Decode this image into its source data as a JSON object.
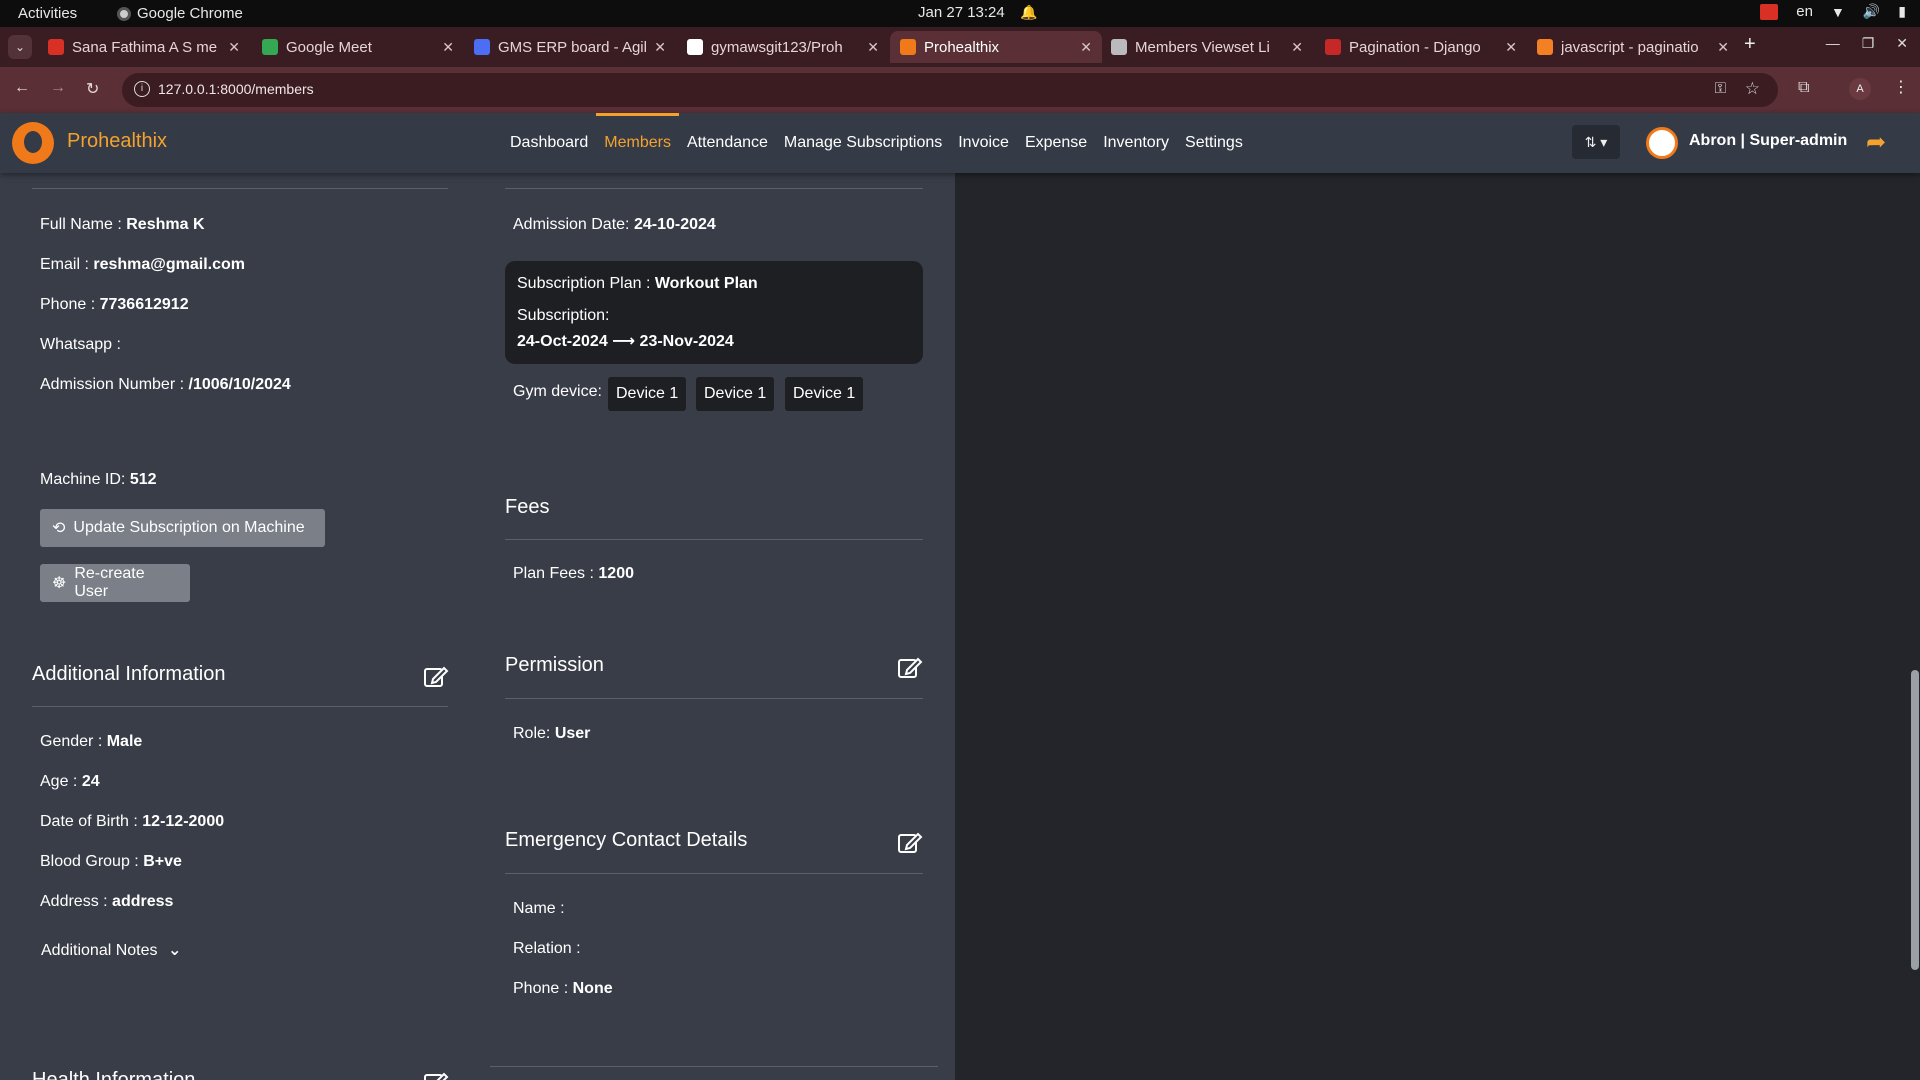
{
  "os": {
    "activities": "Activities",
    "app_name": "Google Chrome",
    "clock": "Jan 27  13:24",
    "lang": "en"
  },
  "browser": {
    "tabs": [
      {
        "title": "Sana Fathima A S me",
        "favicon_color": "#d93025"
      },
      {
        "title": "Google Meet",
        "favicon_color": "#34a853"
      },
      {
        "title": "GMS ERP board - Agil",
        "favicon_color": "#4c6ef5"
      },
      {
        "title": "gymawsgit123/Proh",
        "favicon_color": "#ffffff"
      },
      {
        "title": "Prohealthix",
        "favicon_color": "#f07a1a"
      },
      {
        "title": "Members Viewset Li",
        "favicon_color": "#bbbbbb"
      },
      {
        "title": "Pagination - Django",
        "favicon_color": "#c62828"
      },
      {
        "title": "javascript - paginatio",
        "favicon_color": "#f48024"
      }
    ],
    "url": "127.0.0.1:8000/members",
    "profile_initial": "A"
  },
  "app": {
    "brand": "Prohealthix",
    "nav": [
      "Dashboard",
      "Members",
      "Attendance",
      "Manage Subscriptions",
      "Invoice",
      "Expense",
      "Inventory",
      "Settings"
    ],
    "active_nav": "Members",
    "sort_label": "⇅ ▾",
    "user": "Abron | Super-admin"
  },
  "member": {
    "full_name_label": "Full Name :",
    "full_name": "Reshma K",
    "email_label": "Email :",
    "email": "reshma@gmail.com",
    "phone_label": "Phone :",
    "phone": "7736612912",
    "whatsapp_label": "Whatsapp :",
    "whatsapp": "",
    "admission_number_label": "Admission Number :",
    "admission_number": "/1006/10/2024",
    "machine_id_label": "Machine ID:",
    "machine_id": "512",
    "update_button": "Update Subscription on Machine",
    "recreate_button": "Re-create User",
    "admission_date_label": "Admission Date:",
    "admission_date": "24-10-2024",
    "plan_label": "Subscription Plan :",
    "plan": "Workout Plan",
    "subscription_label": "Subscription:",
    "subscription_range": "24-Oct-2024 ⟶ 23-Nov-2024",
    "gym_device_label": "Gym device:",
    "devices": [
      "Device 1",
      "Device 1",
      "Device 1"
    ]
  },
  "fees": {
    "title": "Fees",
    "plan_fees_label": "Plan Fees :",
    "plan_fees": "1200"
  },
  "additional": {
    "title": "Additional Information",
    "gender_label": "Gender :",
    "gender": "Male",
    "age_label": "Age :",
    "age": "24",
    "dob_label": "Date of Birth :",
    "dob": "12-12-2000",
    "blood_label": "Blood Group :",
    "blood": "B+ve",
    "address_label": "Address :",
    "address": "address",
    "notes_label": "Additional Notes"
  },
  "permission": {
    "title": "Permission",
    "role_label": "Role:",
    "role": "User"
  },
  "emergency": {
    "title": "Emergency Contact Details",
    "name_label": "Name :",
    "name": "",
    "relation_label": "Relation :",
    "relation": "",
    "phone_label": "Phone :",
    "phone": "None"
  },
  "health": {
    "title": "Health Information"
  }
}
